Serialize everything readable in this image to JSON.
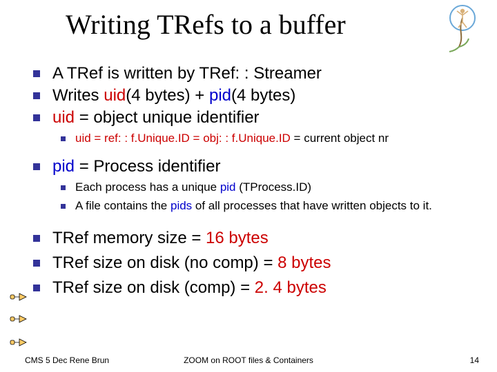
{
  "title": "Writing TRefs to a buffer",
  "bullets": {
    "b1": "A TRef is written by TRef: : Streamer",
    "b2a": "Writes ",
    "b2b": "uid",
    "b2c": "(4 bytes) + ",
    "b2d": "pid",
    "b2e": "(4 bytes)",
    "b3a": "uid",
    "b3b": " = object unique identifier",
    "b3suba": "uid = ref: : f.Unique.ID = obj: : f.Unique.ID",
    "b3subb": " = current object nr",
    "b4a": "pid",
    "b4b": " = Process identifier",
    "b4sub1a": "Each process has a unique ",
    "b4sub1b": "pid",
    "b4sub1c": " (TProcess.ID)",
    "b4sub2a": "A file contains the ",
    "b4sub2b": "pids",
    "b4sub2c": " of all processes that have written objects to it.",
    "b5a": "TRef memory size = ",
    "b5b": "16 bytes",
    "b6a": "TRef size on disk (no comp)  = ",
    "b6b": "8 bytes",
    "b7a": "TRef size on disk (comp) = ",
    "b7b": "2. 4 bytes"
  },
  "footer": {
    "left": "CMS 5 Dec  Rene Brun",
    "center": "ZOOM on ROOT files & Containers",
    "right": "14"
  }
}
